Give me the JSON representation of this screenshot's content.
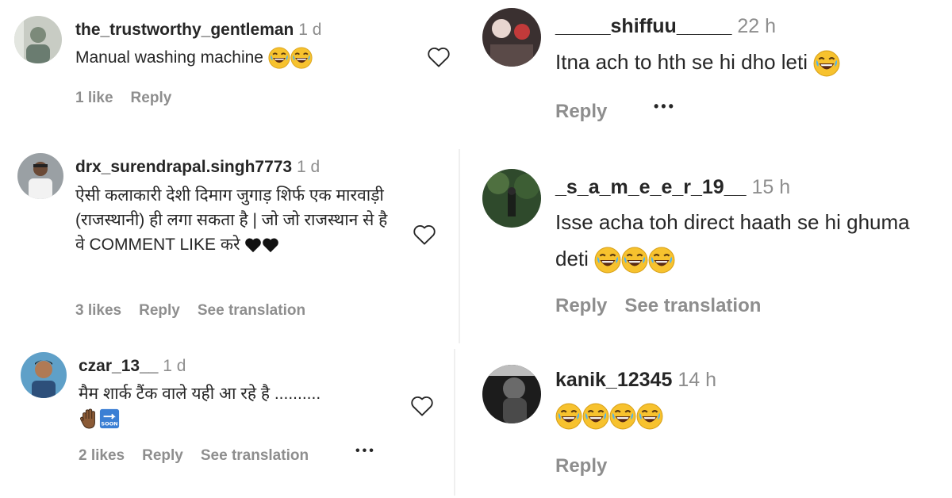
{
  "comments": [
    {
      "username": "the_trustworthy_gentleman",
      "time": "1 d",
      "text": "Manual washing machine",
      "emojis": [
        "laughing-emoji",
        "laughing-emoji"
      ],
      "likes": "1 like",
      "reply": "Reply"
    },
    {
      "username": "drx_surendrapal.singh7773",
      "time": "1 d",
      "text": "ऐसी कलाकारी देशी दिमाग जुगाड़ शिर्फ एक मारवाड़ी (राजस्थानी) ही लगा सकता है | जो जो राजस्थान से है वे COMMENT LIKE करे",
      "emojis": [
        "black-heart-emoji",
        "black-heart-emoji"
      ],
      "likes": "3 likes",
      "reply": "Reply",
      "translate": "See translation"
    },
    {
      "username": "czar_13__",
      "time": "1 d",
      "text": "मैम शार्क टैंक वाले यही आ रहे है ..........",
      "emojis": [
        "raised-hand-emoji",
        "soon-arrow-emoji"
      ],
      "likes": "2 likes",
      "reply": "Reply",
      "translate": "See translation",
      "more": "•••"
    },
    {
      "username": "_____shiffuu_____",
      "time": "22 h",
      "text": "Itna ach to hth se hi dho leti",
      "emojis": [
        "laughing-emoji"
      ],
      "reply": "Reply",
      "more": "•••"
    },
    {
      "username": "_s_a_m_e_e_r_19__",
      "time": "15 h",
      "text": "Isse acha toh direct haath se hi ghuma deti",
      "emojis": [
        "laughing-emoji",
        "laughing-emoji",
        "laughing-emoji"
      ],
      "reply": "Reply",
      "translate": "See translation"
    },
    {
      "username": "kanik_12345",
      "time": "14 h",
      "text": "",
      "emojis": [
        "laughing-emoji",
        "laughing-emoji",
        "laughing-emoji",
        "laughing-emoji"
      ],
      "reply": "Reply"
    }
  ]
}
